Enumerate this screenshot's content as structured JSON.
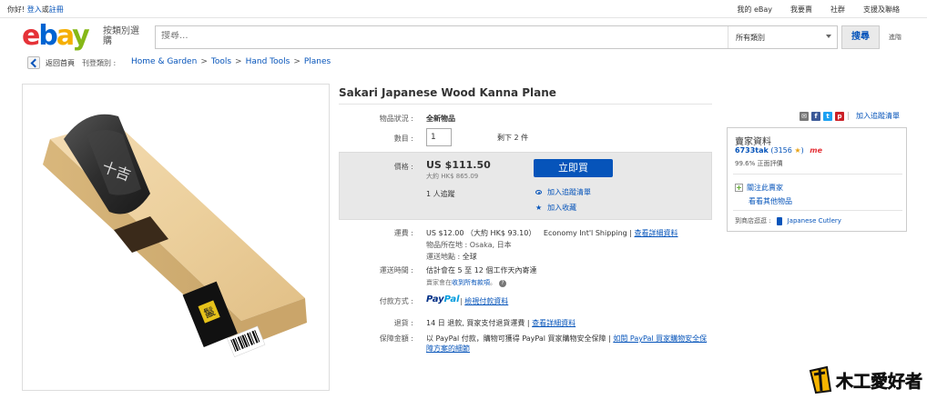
{
  "topbar": {
    "greeting": "你好!",
    "signin": "登入",
    "or": "或",
    "register": "註冊",
    "links": [
      "我的 eBay",
      "我要賣",
      "社群",
      "支援及聯絡"
    ]
  },
  "header": {
    "logo": {
      "e": "e",
      "b": "b",
      "a": "a",
      "y": "y"
    },
    "category_browse": "按類別選購",
    "search_placeholder": "搜尋...",
    "category_select": "所有類別",
    "search_button": "搜尋",
    "advanced": "進階"
  },
  "breadcrumb": {
    "back": "返回首頁",
    "listed_in": "刊登類別 :",
    "items": [
      "Home & Garden",
      ">",
      "Tools",
      ">",
      "Hand Tools",
      ">",
      "Planes"
    ]
  },
  "item": {
    "title": "Sakari Japanese Wood Kanna Plane",
    "condition_label": "物品狀況 :",
    "condition": "全新物品",
    "quantity_label": "數目 :",
    "quantity": "1",
    "quantity_avail": "剩下 2 件",
    "price_label": "價格 :",
    "price": "US $111.50",
    "price_approx": "大約 HK$ 865.09",
    "watchers": "1 人追蹤",
    "buy_now": "立即買",
    "add_watch": "加入追蹤清單",
    "add_collection": "加入收藏"
  },
  "shipping": {
    "label": "運費 :",
    "cost": "US $12.00 （大約 HK$ 93.10）",
    "service": "Economy Int'l Shipping |",
    "details_link": "查看詳細資料",
    "location_label": "物品所在地 :",
    "location": "Osaka, 日本",
    "ships_to_label": "運送地點 :",
    "ships_to": "全球"
  },
  "delivery": {
    "label": "運送時間 :",
    "text": "估計會在 5 至 12 個工作天內寄達",
    "note_prefix": "賣家會在",
    "note_link": "收到所有款項",
    "note_suffix": "。"
  },
  "payment": {
    "label": "付款方式 :",
    "paypal_1": "Pay",
    "paypal_2": "Pal",
    "sep": "|",
    "link": "檢視付款資料"
  },
  "returns": {
    "label": "退貨 :",
    "text": "14 日 退款, 買家支付退貨運費 |",
    "link": "查看詳細資料"
  },
  "guarantee": {
    "label": "保障金額 :",
    "text": "以 PayPal 付款，購物可獲得 PayPal 買家購物安全保障 |",
    "link1": "如閱 PayPal 買家購物安全保障方案的細節"
  },
  "share": {
    "icons": [
      "mail-icon",
      "facebook-icon",
      "twitter-icon",
      "pinterest-icon"
    ],
    "add_to_list": "加入追蹤清單"
  },
  "seller": {
    "title": "賣家資料",
    "name": "6733tak",
    "feedback_count": "(3156",
    "feedback_close": ")",
    "me": "me",
    "positive": "99.6% 正面評價",
    "save": "關注此賣家",
    "other_items": "看看其他物品",
    "visit_store": "到商店逛逛 :",
    "store": "Japanese Cutlery"
  },
  "product_image": {
    "label_text": "十吉",
    "brand_char": "鬣"
  },
  "watermark": {
    "text": "木工愛好者"
  }
}
